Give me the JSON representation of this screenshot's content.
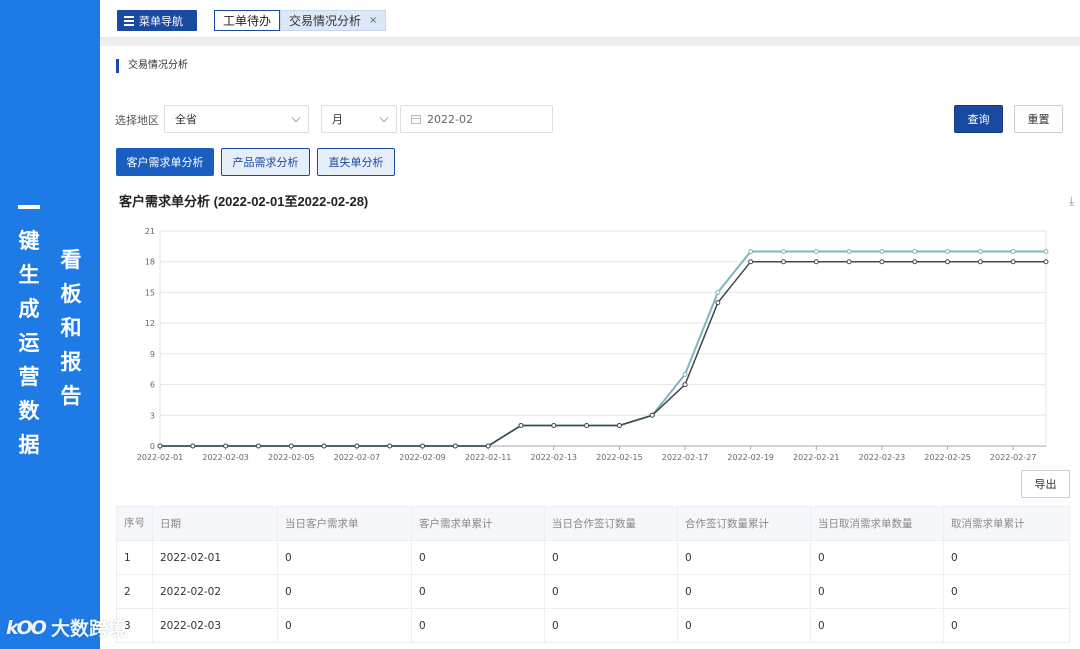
{
  "banner": {
    "col1": [
      "键",
      "生",
      "成",
      "运",
      "营",
      "数",
      "据"
    ],
    "col2": [
      "看",
      "板",
      "和",
      "报",
      "告"
    ]
  },
  "watermark": {
    "logo": "kOO",
    "text": "大数跨境"
  },
  "topbar": {
    "menu_label": "菜单导航",
    "tabs": [
      {
        "label": "工单待办"
      },
      {
        "label": "交易情况分析",
        "close": "×"
      }
    ]
  },
  "section_title": "交易情况分析",
  "filters": {
    "region_label": "选择地区",
    "region_value": "全省",
    "period_value": "月",
    "date_value": "2022-02",
    "query_label": "查询",
    "reset_label": "重置"
  },
  "subtabs": [
    "客户需求单分析",
    "产品需求分析",
    "直失单分析"
  ],
  "chart_title": "客户需求单分析 (2022-02-01至2022-02-28)",
  "export_label": "导出",
  "chart_data": {
    "type": "line",
    "title": "客户需求单分析 (2022-02-01至2022-02-28)",
    "x": [
      "2022-02-01",
      "2022-02-02",
      "2022-02-03",
      "2022-02-04",
      "2022-02-05",
      "2022-02-06",
      "2022-02-07",
      "2022-02-08",
      "2022-02-09",
      "2022-02-10",
      "2022-02-11",
      "2022-02-12",
      "2022-02-13",
      "2022-02-14",
      "2022-02-15",
      "2022-02-16",
      "2022-02-17",
      "2022-02-18",
      "2022-02-19",
      "2022-02-20",
      "2022-02-21",
      "2022-02-22",
      "2022-02-23",
      "2022-02-24",
      "2022-02-25",
      "2022-02-26",
      "2022-02-27",
      "2022-02-28"
    ],
    "x_tick_labels": [
      "2022-02-01",
      "2022-02-03",
      "2022-02-05",
      "2022-02-07",
      "2022-02-09",
      "2022-02-11",
      "2022-02-13",
      "2022-02-15",
      "2022-02-17",
      "2022-02-19",
      "2022-02-21",
      "2022-02-23",
      "2022-02-25",
      "2022-02-27"
    ],
    "ylim": [
      0,
      21
    ],
    "y_ticks": [
      0,
      3,
      6,
      9,
      12,
      15,
      18,
      21
    ],
    "grid": true,
    "series": [
      {
        "color": "#7fb6bf",
        "values": [
          0,
          0,
          0,
          0,
          0,
          0,
          0,
          0,
          0,
          0,
          0,
          2,
          2,
          2,
          2,
          3,
          7,
          15,
          19,
          19,
          19,
          19,
          19,
          19,
          19,
          19,
          19,
          19
        ]
      },
      {
        "color": "#404850",
        "values": [
          0,
          0,
          0,
          0,
          0,
          0,
          0,
          0,
          0,
          0,
          0,
          2,
          2,
          2,
          2,
          3,
          6,
          14,
          18,
          18,
          18,
          18,
          18,
          18,
          18,
          18,
          18,
          18
        ]
      }
    ]
  },
  "table": {
    "headers": [
      "序号",
      "日期",
      "当日客户需求单",
      "客户需求单累计",
      "当日合作签订数量",
      "合作签订数量累计",
      "当日取消需求单数量",
      "取消需求单累计"
    ],
    "rows": [
      [
        "1",
        "2022-02-01",
        "0",
        "0",
        "0",
        "0",
        "0",
        "0"
      ],
      [
        "2",
        "2022-02-02",
        "0",
        "0",
        "0",
        "0",
        "0",
        "0"
      ],
      [
        "3",
        "2022-02-03",
        "0",
        "0",
        "0",
        "0",
        "0",
        "0"
      ]
    ]
  }
}
